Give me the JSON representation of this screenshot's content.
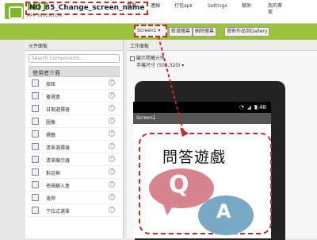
{
  "app": {
    "name": "MIT",
    "sub": "APP INVENTOR"
  },
  "nav": [
    "專案",
    "連線",
    "打包apk",
    "Settings",
    "幫助",
    "我的專案"
  ],
  "project": {
    "name": "NO_85_Change_screen_name",
    "screen_selector": "Screen1 ▾",
    "buttons": [
      "新增螢幕",
      "刪除螢幕",
      "發佈作品到Gallery"
    ]
  },
  "palette": {
    "header": "元件面板",
    "search_placeholder": "Search Components...",
    "category": "使用者介面",
    "items": [
      {
        "label": "按鈕",
        "icon": "button-icon"
      },
      {
        "label": "複選盒",
        "icon": "checkbox-icon"
      },
      {
        "label": "日期選擇器",
        "icon": "datepicker-icon"
      },
      {
        "label": "圖像",
        "icon": "image-icon"
      },
      {
        "label": "標籤",
        "icon": "label-icon"
      },
      {
        "label": "清單選擇器",
        "icon": "listpicker-icon"
      },
      {
        "label": "清單顯示器",
        "icon": "listview-icon"
      },
      {
        "label": "對話框",
        "icon": "notifier-icon"
      },
      {
        "label": "密碼輸入盒",
        "icon": "password-icon"
      },
      {
        "label": "滑桿",
        "icon": "slider-icon"
      },
      {
        "label": "下拉式選單",
        "icon": "spinner-icon"
      }
    ],
    "help": "?"
  },
  "viewer": {
    "header": "工作面板",
    "checkbox_label": "顯示隱藏元件",
    "size_selector": "手機尺寸 (505,320) ▾",
    "clock": "9:48",
    "screen_title": "Screen1",
    "content_title": "問答遊戲",
    "q": "Q",
    "a": "A"
  },
  "colors": {
    "accent": "#9ac23c",
    "highlight": "#c42a2a",
    "bubble_q": "#d8848f",
    "bubble_a": "#7aa9c6"
  }
}
